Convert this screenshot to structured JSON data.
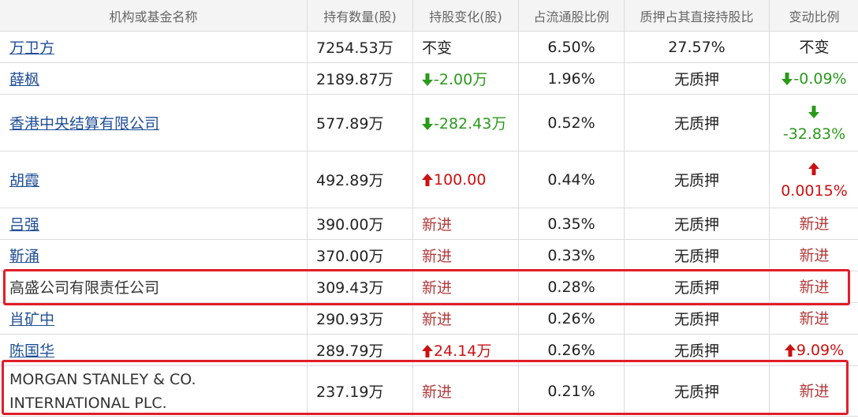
{
  "columns": [
    "机构或基金名称",
    "持有数量(股)",
    "持股变化(股)",
    "占流通股比例",
    "质押占其直接持股比",
    "变动比例"
  ],
  "rows": [
    {
      "name": "万卫方",
      "link": true,
      "qty": "7254.53万",
      "change": "不变",
      "change_dir": "none",
      "ratio": "6.50%",
      "pledge": "27.57%",
      "vary": "不变",
      "vary_dir": "none"
    },
    {
      "name": "薛枫",
      "link": true,
      "qty": "2189.87万",
      "change": "-2.00万",
      "change_dir": "down",
      "ratio": "1.96%",
      "pledge": "无质押",
      "vary": "-0.09%",
      "vary_dir": "down"
    },
    {
      "name": "香港中央结算有限公司",
      "link": true,
      "qty": "577.89万",
      "change": "-282.43万",
      "change_dir": "down",
      "ratio": "0.52%",
      "pledge": "无质押",
      "vary": "-32.83%",
      "vary_dir": "down"
    },
    {
      "name": "胡霞",
      "link": true,
      "qty": "492.89万",
      "change": "100.00",
      "change_dir": "up",
      "ratio": "0.44%",
      "pledge": "无质押",
      "vary": "0.0015%",
      "vary_dir": "up"
    },
    {
      "name": "吕强",
      "link": true,
      "qty": "390.00万",
      "change": "新进",
      "change_dir": "new",
      "ratio": "0.35%",
      "pledge": "无质押",
      "vary": "新进",
      "vary_dir": "new"
    },
    {
      "name": "靳涌",
      "link": true,
      "qty": "370.00万",
      "change": "新进",
      "change_dir": "new",
      "ratio": "0.33%",
      "pledge": "无质押",
      "vary": "新进",
      "vary_dir": "new"
    },
    {
      "name": "高盛公司有限责任公司",
      "link": false,
      "qty": "309.43万",
      "change": "新进",
      "change_dir": "new",
      "ratio": "0.28%",
      "pledge": "无质押",
      "vary": "新进",
      "vary_dir": "new"
    },
    {
      "name": "肖矿中",
      "link": true,
      "qty": "290.93万",
      "change": "新进",
      "change_dir": "new",
      "ratio": "0.26%",
      "pledge": "无质押",
      "vary": "新进",
      "vary_dir": "new"
    },
    {
      "name": "陈国华",
      "link": true,
      "qty": "289.79万",
      "change": "24.14万",
      "change_dir": "up",
      "ratio": "0.26%",
      "pledge": "无质押",
      "vary": "9.09%",
      "vary_dir": "up"
    },
    {
      "name": "MORGAN STANLEY & CO. INTERNATIONAL PLC.",
      "link": false,
      "qty": "237.19万",
      "change": "新进",
      "change_dir": "new",
      "ratio": "0.21%",
      "pledge": "无质押",
      "vary": "新进",
      "vary_dir": "new"
    }
  ],
  "highlighted_rows": [
    6,
    9
  ],
  "colors": {
    "up": "#cc1111",
    "down": "#2a9a1a",
    "new": "#b33a3a",
    "link": "#1f4e96",
    "highlight": "#e01e2a"
  },
  "icons": {
    "up": "arrow-up-icon",
    "down": "arrow-down-icon"
  }
}
